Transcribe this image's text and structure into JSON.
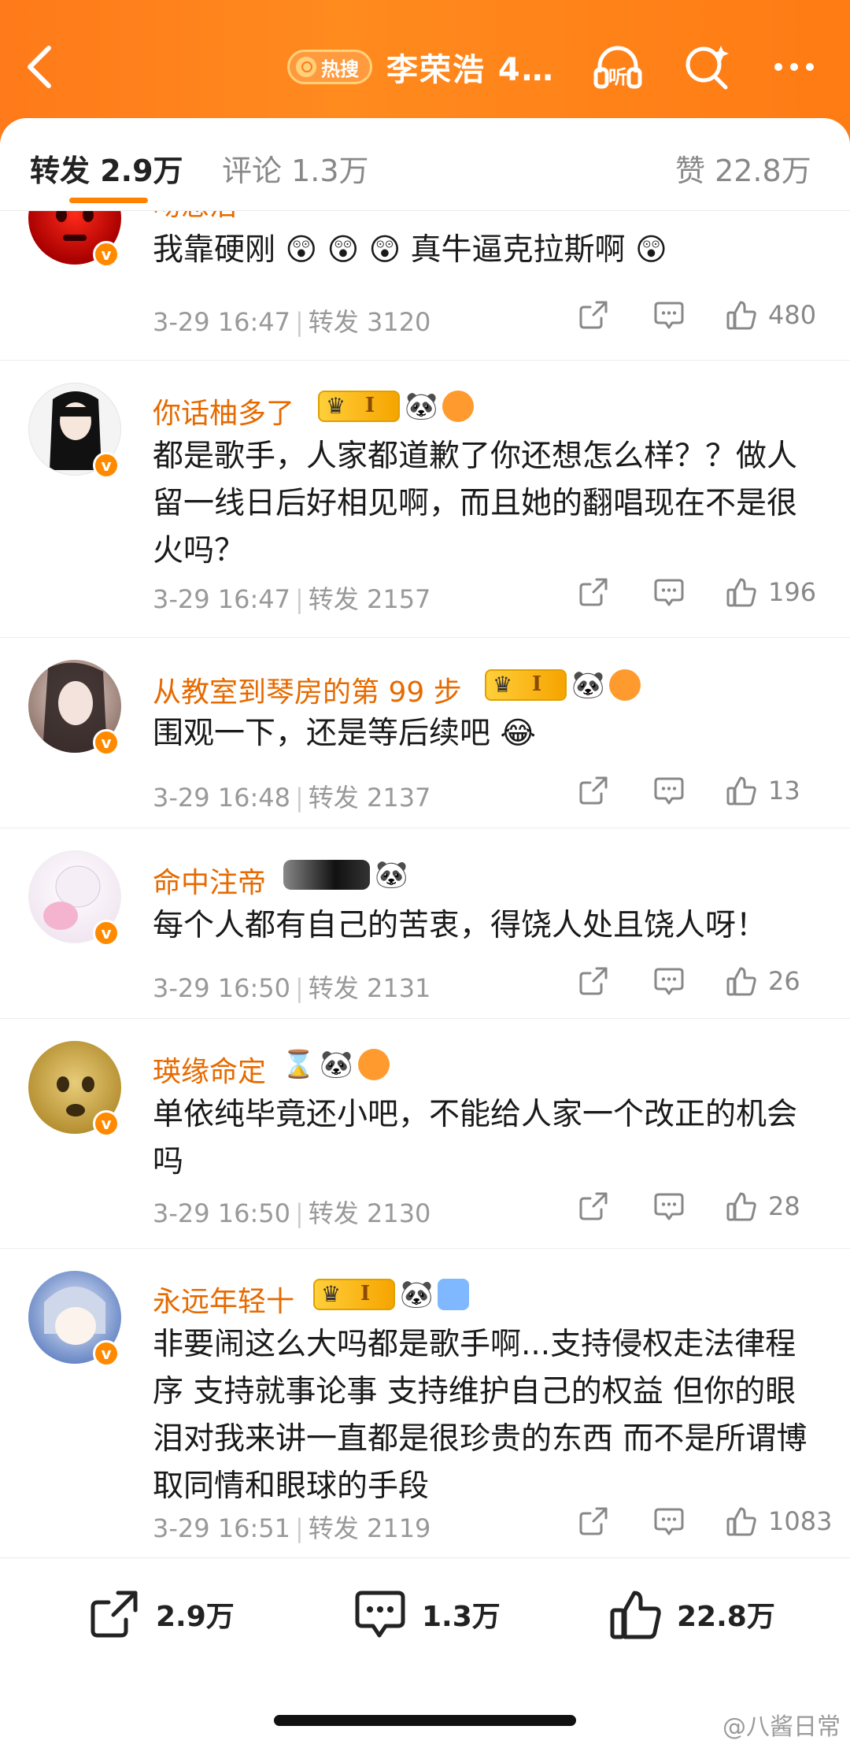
{
  "header": {
    "back_icon": "chevron-left-icon",
    "hot_badge": "热搜",
    "topic": "李荣浩 4…",
    "listen_icon": "headphones-listen-icon",
    "listen_label": "听",
    "search_icon": "search-sparkle-icon",
    "more_icon": "more-dots-icon",
    "brand_color": "#ff7a1a"
  },
  "tabs": {
    "repost": "转发 2.9万",
    "comment": "评论 1.3万",
    "like": "赞 22.8万"
  },
  "comments": [
    {
      "username": "吻憋治",
      "text": "我靠硬刚 😲 😲 😲 真牛逼克拉斯啊 😲",
      "time": "3-29 16:47",
      "repost_label": "转发 3120",
      "likes": "480"
    },
    {
      "username": "你话柚多了",
      "text": "都是歌手，人家都道歉了你还想怎么样？？做人留一线日后好相见啊，而且她的翻唱现在不是很火吗？",
      "time": "3-29 16:47",
      "repost_label": "转发 2157",
      "likes": "196"
    },
    {
      "username": "从教室到琴房的第 99 步",
      "text": "围观一下，还是等后续吧 😂",
      "time": "3-29 16:48",
      "repost_label": "转发 2137",
      "likes": "13"
    },
    {
      "username": "命中注帝",
      "text": "每个人都有自己的苦衷，得饶人处且饶人呀！",
      "time": "3-29 16:50",
      "repost_label": "转发 2131",
      "likes": "26"
    },
    {
      "username": "瑛缘命定",
      "text": "单依纯毕竟还小吧，不能给人家一个改正的机会吗",
      "time": "3-29 16:50",
      "repost_label": "转发 2130",
      "likes": "28"
    },
    {
      "username": "永远年轻十",
      "text": "非要闹这么大吗都是歌手啊...支持侵权走法律程序 支持就事论事 支持维护自己的权益 但你的眼泪对我来讲一直都是很珍贵的东西 而不是所谓博取同情和眼球的手段",
      "time": "3-29 16:51",
      "repost_label": "转发 2119",
      "likes": "1083"
    }
  ],
  "bottom": {
    "repost": "2.9万",
    "comment": "1.3万",
    "like": "22.8万"
  },
  "watermark": "@八酱日常"
}
